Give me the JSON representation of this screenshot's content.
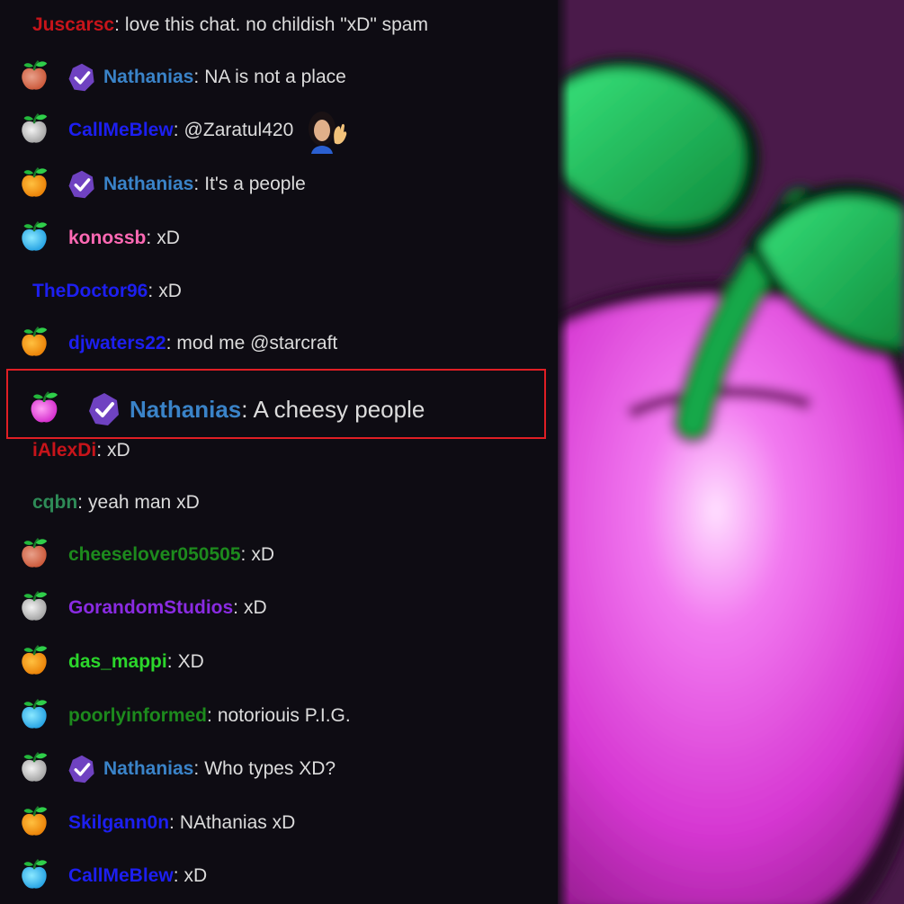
{
  "chat": {
    "messages": [
      {
        "icon": null,
        "badge": false,
        "username": "Juscarsc",
        "user_color": "#c7141a",
        "text": "love this chat. no childish \"xD\" spam",
        "emote": null
      },
      {
        "icon": "red",
        "badge": true,
        "username": "Nathanias",
        "user_color": "#3a83c8",
        "text": "NA is not a place",
        "emote": null
      },
      {
        "icon": "gray",
        "badge": false,
        "username": "CallMeBlew",
        "user_color": "#1d1ff0",
        "text": "@Zaratul420",
        "emote": "waving-person"
      },
      {
        "icon": "orange",
        "badge": true,
        "username": "Nathanias",
        "user_color": "#3a83c8",
        "text": "It's a people",
        "emote": null
      },
      {
        "icon": "blue",
        "badge": false,
        "username": "konossb",
        "user_color": "#ff69b4",
        "text": "xD",
        "emote": null
      },
      {
        "icon": null,
        "badge": false,
        "username": "TheDoctor96",
        "user_color": "#1d1ff0",
        "text": "xD",
        "emote": null
      },
      {
        "icon": "orange",
        "badge": false,
        "username": "djwaters22",
        "user_color": "#1d1ff0",
        "text": "mod me @starcraft",
        "emote": null
      },
      {
        "icon": "pink",
        "badge": true,
        "username": "Nathanias",
        "user_color": "#3a83c8",
        "text": "A cheesy people",
        "emote": null,
        "highlighted": true
      },
      {
        "icon": null,
        "badge": false,
        "username": "iAlexDi",
        "user_color": "#c7141a",
        "text": "xD",
        "emote": null
      },
      {
        "icon": null,
        "badge": false,
        "username": "cqbn",
        "user_color": "#2e8b57",
        "text": "yeah man xD",
        "emote": null
      },
      {
        "icon": "red",
        "badge": false,
        "username": "cheeselover050505",
        "user_color": "#1d8a1d",
        "text": "xD",
        "emote": null
      },
      {
        "icon": "gray",
        "badge": false,
        "username": "GorandomStudios",
        "user_color": "#8a2be2",
        "text": "xD",
        "emote": null
      },
      {
        "icon": "orange",
        "badge": false,
        "username": "das_mappi",
        "user_color": "#2bd62b",
        "text": "XD",
        "emote": null
      },
      {
        "icon": "blue",
        "badge": false,
        "username": "poorlyinformed",
        "user_color": "#1d8a1d",
        "text": "notoriouis P.I.G.",
        "emote": null
      },
      {
        "icon": "gray",
        "badge": true,
        "username": "Nathanias",
        "user_color": "#3a83c8",
        "text": "Who types XD?",
        "emote": null
      },
      {
        "icon": "orange",
        "badge": false,
        "username": "Skilgann0n",
        "user_color": "#1d1ff0",
        "text": "NAthanias xD",
        "emote": null
      },
      {
        "icon": "blue",
        "badge": false,
        "username": "CallMeBlew",
        "user_color": "#1d1ff0",
        "text": "xD",
        "emote": null
      }
    ],
    "separator": ":",
    "badge_icon": "verified-check-badge-icon",
    "sub_icon": "apple-subscriber-icon",
    "apple_colors": {
      "red": [
        "#e8a08a",
        "#c85030"
      ],
      "gray": [
        "#f2f2f2",
        "#9a9a9a"
      ],
      "orange": [
        "#ffc040",
        "#e87a00"
      ],
      "blue": [
        "#8ae8ff",
        "#1a9ae0"
      ],
      "pink": [
        "#ff9ff5",
        "#d020c8"
      ]
    },
    "badge_color": "#6f42c1"
  },
  "background_art": {
    "icon": "apple-emote-art-icon",
    "apple_color": "#e040e0",
    "leaf_color": "#1fbf5a",
    "bg_color": "#4a1a4a"
  }
}
